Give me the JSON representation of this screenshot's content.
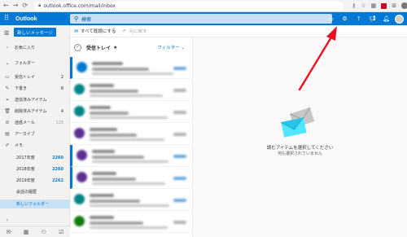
{
  "browser": {
    "url": "outlook.office.com/mail/inbox"
  },
  "app": {
    "title": "Outlook",
    "search_placeholder": "検索",
    "new_message": "新しいメッセージ"
  },
  "toolbar": {
    "mark_all_read": "すべて既読にする",
    "undo": "元に戻す"
  },
  "nav": {
    "favorites": "お気に入り",
    "folders": "フォルダー",
    "items": [
      {
        "label": "受信トレイ",
        "count": "2"
      },
      {
        "label": "下書き",
        "count": "8"
      },
      {
        "label": "送信済みアイテム",
        "count": ""
      },
      {
        "label": "削除済みアイテム",
        "count": "4"
      },
      {
        "label": "迷惑メール",
        "count": "115"
      },
      {
        "label": "アーカイブ",
        "count": ""
      },
      {
        "label": "メモ",
        "count": ""
      }
    ],
    "subfolders": [
      {
        "label": "2017年度",
        "count": "2260"
      },
      {
        "label": "2018年度",
        "count": "2260"
      },
      {
        "label": "2019年度",
        "count": "2262"
      },
      {
        "label": "会話の履歴",
        "count": ""
      }
    ],
    "new_folder": "新しいフォルダー"
  },
  "list": {
    "title": "受信トレイ",
    "filter": "フィルター"
  },
  "reading": {
    "empty_title": "読むアイテムを選択してください",
    "empty_sub": "何も選択されていません"
  },
  "colors": {
    "accent": "#0078d4",
    "annotation_arrow": "#e81123"
  },
  "icons": {
    "topbar": [
      "meet-now-icon",
      "gear-icon",
      "help-icon",
      "megaphone-icon",
      "bell-icon"
    ]
  }
}
